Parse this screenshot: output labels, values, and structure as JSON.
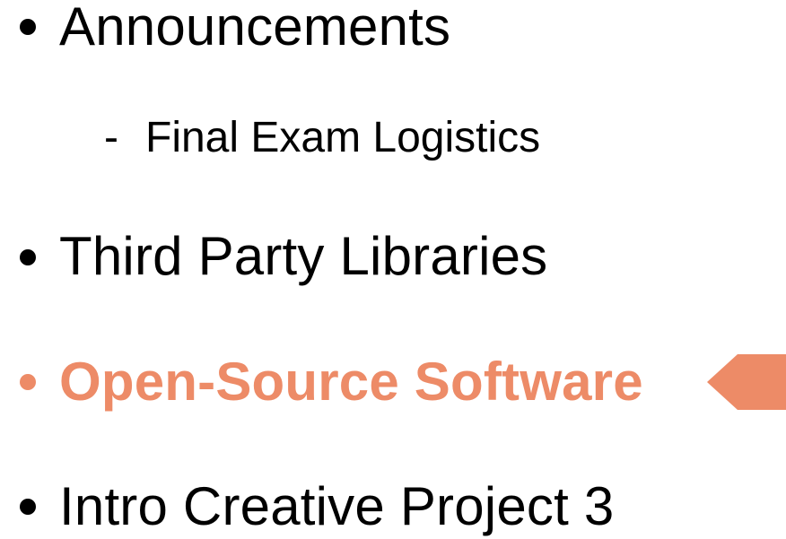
{
  "agenda": {
    "items": [
      {
        "label": "Announcements"
      },
      {
        "label": "Third Party Libraries"
      },
      {
        "label": "Open-Source Software"
      },
      {
        "label": "Intro Creative Project 3"
      }
    ],
    "sub_items": [
      {
        "dash": "-",
        "label": "Final Exam Logistics"
      }
    ],
    "current_item_index": 2
  },
  "colors": {
    "text": "#000000",
    "highlight": "#ED8B67",
    "background": "#ffffff"
  },
  "icons": {
    "current_marker": "left-pointing-arrow-icon"
  }
}
